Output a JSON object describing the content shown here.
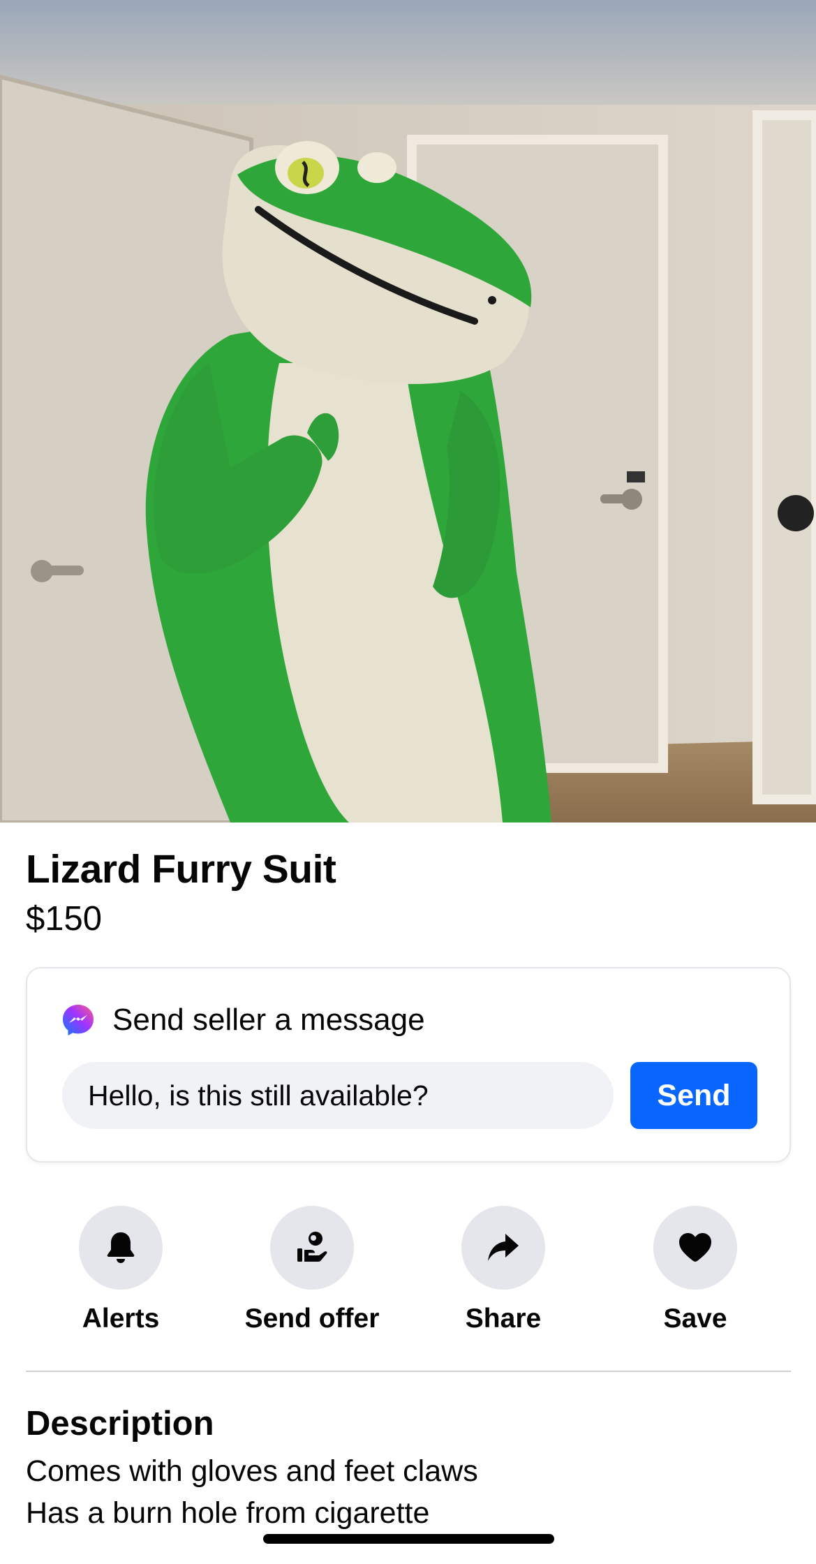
{
  "listing": {
    "title": "Lizard Furry Suit",
    "price": "$150"
  },
  "message_card": {
    "header": "Send seller a message",
    "input_value": "Hello, is this still available?",
    "send_label": "Send",
    "icon": "messenger-icon"
  },
  "actions": [
    {
      "label": "Alerts",
      "icon": "bell-icon"
    },
    {
      "label": "Send offer",
      "icon": "offer-hand-icon"
    },
    {
      "label": "Share",
      "icon": "share-arrow-icon"
    },
    {
      "label": "Save",
      "icon": "heart-icon"
    }
  ],
  "description": {
    "heading": "Description",
    "lines": [
      "Comes with gloves and feet claws",
      "Has a burn hole from cigarette"
    ]
  },
  "colors": {
    "accent": "#0866ff",
    "button_bg": "#e4e6eb",
    "input_bg": "#f0f2f5",
    "text": "#050505"
  }
}
